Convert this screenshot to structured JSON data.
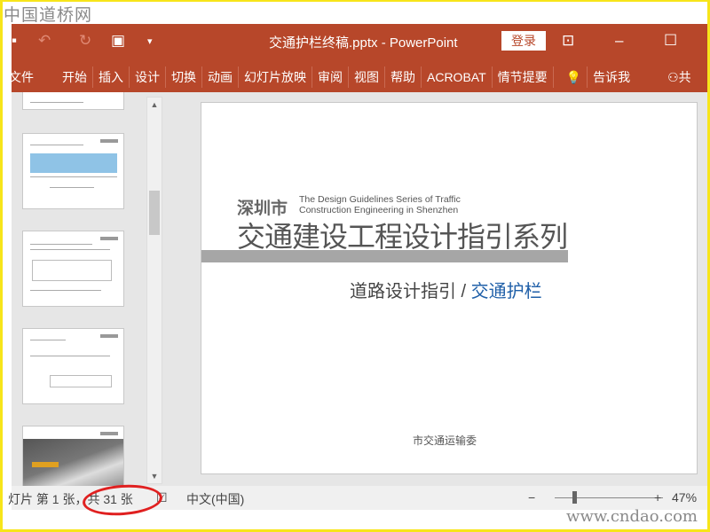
{
  "watermark_top": "中国道桥网",
  "watermark_bottom": "www.cndao.com",
  "titlebar": {
    "title": "交通护栏终稿.pptx  -  PowerPoint",
    "login": "登录"
  },
  "ribbon": {
    "tabs": [
      "文件",
      "开始",
      "插入",
      "设计",
      "切换",
      "动画",
      "幻灯片放映",
      "审阅",
      "视图",
      "帮助",
      "ACROBAT",
      "情节提要"
    ],
    "tell_me": "告诉我",
    "share": "共"
  },
  "slide": {
    "city": "深圳市",
    "english_line1": "The Design Guidelines Series of Traffic",
    "english_line2": "Construction Engineering in Shenzhen",
    "title": "交通建设工程设计指引系列",
    "subtitle_prefix": "道路设计指引 / ",
    "subtitle_highlight": "交通护栏",
    "organization": "市交通运输委"
  },
  "status": {
    "slide_info": "灯片 第 1 张，共 31 张",
    "language": "中文(中国)",
    "zoom": "47%",
    "zoom_minus": "−",
    "zoom_plus": "+"
  },
  "colors": {
    "accent": "#b7472a",
    "highlight": "#1f5fa8"
  }
}
